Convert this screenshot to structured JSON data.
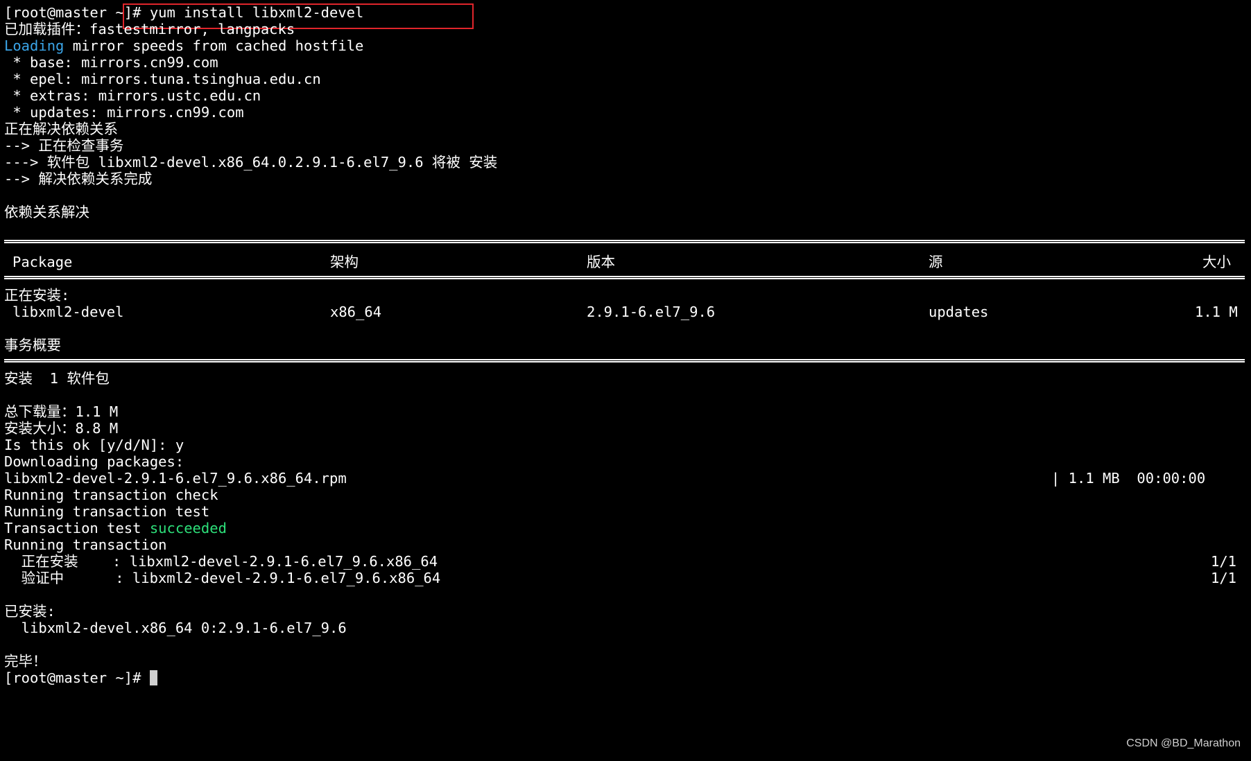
{
  "terminal": {
    "prompt_cmd": "[root@master ~]# yum install libxml2-devel",
    "plugins_line": "已加载插件：fastestmirror, langpacks",
    "loading_word": "Loading",
    "loading_rest": " mirror speeds from cached hostfile",
    "mirror_base": " * base: mirrors.cn99.com",
    "mirror_epel": " * epel: mirrors.tuna.tsinghua.edu.cn",
    "mirror_extras": " * extras: mirrors.ustc.edu.cn",
    "mirror_updates": " * updates: mirrors.cn99.com",
    "resolving": "正在解决依赖关系",
    "checking": "--> 正在检查事务",
    "pkg_will_install": "---> 软件包 libxml2-devel.x86_64.0.2.9.1-6.el7_9.6 将被 安装",
    "resolve_done": "--> 解决依赖关系完成",
    "deps_resolved": "依赖关系解决",
    "table_headers": {
      "package": "Package",
      "arch": "架构",
      "version": "版本",
      "repo": "源",
      "size": "大小"
    },
    "installing_label": "正在安装:",
    "table_row": {
      "package": "libxml2-devel",
      "arch": "x86_64",
      "version": "2.9.1-6.el7_9.6",
      "repo": "updates",
      "size": "1.1 M"
    },
    "summary_label": "事务概要",
    "install_count": "安装  1 软件包",
    "total_download": "总下载量：1.1 M",
    "installed_size": "安装大小：8.8 M",
    "confirm": "Is this ok [y/d/N]: y",
    "downloading": "Downloading packages:",
    "rpm_file": "libxml2-devel-2.9.1-6.el7_9.6.x86_64.rpm",
    "rpm_stats": "| 1.1 MB  00:00:00",
    "tx_check": "Running transaction check",
    "tx_test": "Running transaction test",
    "tx_test_result_prefix": "Transaction test ",
    "tx_test_result_word": "succeeded",
    "tx_running": "Running transaction",
    "step_installing": "  正在安装    : libxml2-devel-2.9.1-6.el7_9.6.x86_64",
    "step_installing_count": "1/1",
    "step_verifying": "  验证中      : libxml2-devel-2.9.1-6.el7_9.6.x86_64",
    "step_verifying_count": "1/1",
    "installed_label": "已安装:",
    "installed_pkg": "  libxml2-devel.x86_64 0:2.9.1-6.el7_9.6",
    "complete": "完毕！",
    "final_prompt": "[root@master ~]# "
  },
  "watermark": "CSDN @BD_Marathon",
  "colors": {
    "background": "#000000",
    "text": "#ffffff",
    "loading_blue": "#3ba5e8",
    "success_green": "#2de07a",
    "highlight_red": "#e0252b"
  }
}
